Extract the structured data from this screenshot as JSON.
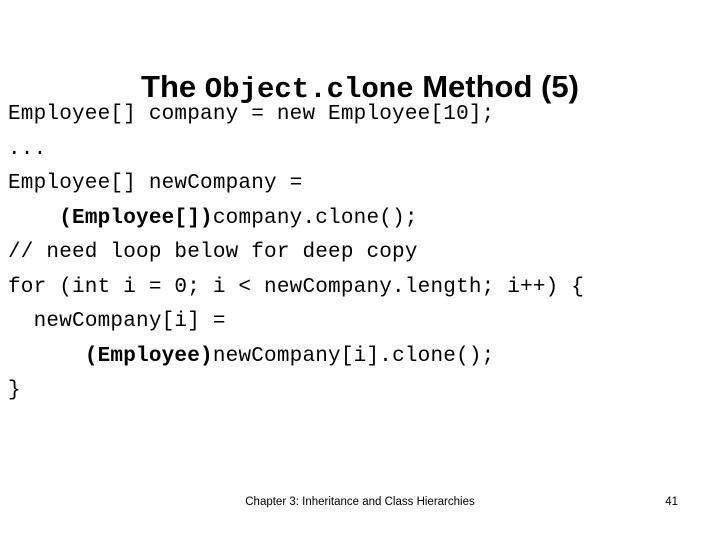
{
  "slide": {
    "title": {
      "prefix": "The ",
      "code": "Object.clone",
      "suffix": " Method (5)"
    },
    "code_lines": [
      {
        "indent": "",
        "segments": [
          {
            "text": "Employee[] company = new Employee[10];",
            "bold": false
          }
        ]
      },
      {
        "indent": "",
        "segments": [
          {
            "text": "...",
            "bold": false
          }
        ]
      },
      {
        "indent": "",
        "segments": [
          {
            "text": "Employee[] newCompany =",
            "bold": false
          }
        ]
      },
      {
        "indent": "    ",
        "segments": [
          {
            "text": "(Employee[])",
            "bold": true
          },
          {
            "text": "company.clone();",
            "bold": false
          }
        ]
      },
      {
        "indent": "",
        "segments": [
          {
            "text": "// need loop below for deep copy",
            "bold": false
          }
        ]
      },
      {
        "indent": "",
        "segments": [
          {
            "text": "for (int i = 0; i < newCompany.length; i++) {",
            "bold": false
          }
        ]
      },
      {
        "indent": "  ",
        "segments": [
          {
            "text": "newCompany[i] =",
            "bold": false
          }
        ]
      },
      {
        "indent": "      ",
        "segments": [
          {
            "text": "(Employee)",
            "bold": true
          },
          {
            "text": "newCompany[i].clone();",
            "bold": false
          }
        ]
      },
      {
        "indent": "",
        "segments": [
          {
            "text": "}",
            "bold": false
          }
        ]
      }
    ],
    "footer": {
      "chapter": "Chapter 3: Inheritance and Class Hierarchies",
      "page_number": "41"
    },
    "colors": {
      "background": "#ffffff",
      "text": "#000000"
    }
  }
}
